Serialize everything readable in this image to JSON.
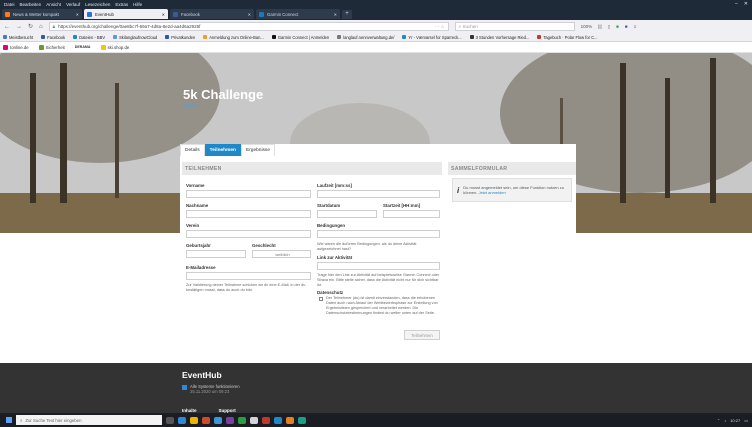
{
  "menubar": {
    "items": [
      "Datei",
      "Bearbeiten",
      "Ansicht",
      "Verlauf",
      "Lesezeichen",
      "Extras",
      "Hilfe"
    ]
  },
  "tabs": [
    {
      "label": "News & Wetter kompakt",
      "color": "#ff7a1a"
    },
    {
      "label": "EventHub",
      "active": true,
      "color": "#2e6fd8"
    },
    {
      "label": "Facebook",
      "color": "#3b5998"
    },
    {
      "label": "Garmin Connect",
      "color": "#1a7abf"
    }
  ],
  "navbar": {
    "url": "https://eventhub.org/challenge/0ae8bc7f-69a7-4d8a-8e2d-aa4d6a2925f",
    "search_placeholder": "Suchen",
    "zoom": "100%"
  },
  "bookmarks": [
    "Meistbesucht",
    "Facebook",
    "Dateien - BBV",
    "SkilanglaufnowCloud",
    "Privatkunden",
    "Anmeldung zum Online-Ban...",
    "Garmin Connect | Anmelden",
    "langlauf.nennverwaltung.de/",
    "Yr - Værvarsel for Sparreck...",
    "3 Stunden Vorhersage Ried...",
    "Tagebuch · Polar Flow for C..."
  ],
  "sitebar": [
    "tonline.de",
    "Sicherheit",
    "DERAMA",
    "ski.shop.de"
  ],
  "hero": {
    "title": "5k Challenge",
    "back_link": "Zurück"
  },
  "page_tabs": [
    "Details",
    "Teilnehmen",
    "Ergebnisse"
  ],
  "form": {
    "header": "TEILNEHMEN",
    "vorname": "Vorname",
    "nachname": "Nachname",
    "verein": "Verein",
    "geburtsjahr": "Geburtsjahr",
    "geschlecht": "Geschlecht",
    "geschlecht_value": "weiblich",
    "email": "E-Mailadresse",
    "email_note": "Zur Validierung deiner Teilnahme schicken wir dir eine E-Mail, in der du bestätigen musst, dass du auch du bist.",
    "laufzeit": "Laufzeit [mm:ss]",
    "startdatum": "Startdatum",
    "startzeit": "Startzeit [HH:mm]",
    "bedingungen": "Bedingungen",
    "bedingungen_note": "Wie waren die äußeren Bedingungen, als du deine Aktivität aufgezeichnet hast?",
    "link": "Link zur Aktivität",
    "link_note": "Trage hier den Link zur Aktivität auf beispielsweise Garmin Connect oder Strava ein. Bitte stelle sicher, dass die Aktivität nicht nur für dich sichtbar ist.",
    "datenschutz": "Datenschutz",
    "datenschutz_note": "Der Teilnehmer (du) ist damit einverstanden, dass die erhobenen Daten auch nach Ablauf der Wettbewerbsphase zur Erstellung von Ergebnislisten gespeichert und verarbeitet werden. Die Datenschutzbestimmungen findest du weiter unten auf der Seite.",
    "submit": "Teilnehmen"
  },
  "sammel": {
    "header": "SAMMELFORMULAR",
    "icon": "i",
    "text": "Du musst angemeldet sein, um diese Funktion nutzen zu können.",
    "link": "Jetzt anmelden"
  },
  "footer": {
    "title": "EventHub",
    "status": "Alle Systeme funktionieren",
    "status_date": "25.11.2020 um 09:23",
    "links": [
      "Inhalte",
      "Support"
    ]
  },
  "taskbar": {
    "search_placeholder": "Zur Suche Text hier eingeben",
    "time": "10:27"
  }
}
